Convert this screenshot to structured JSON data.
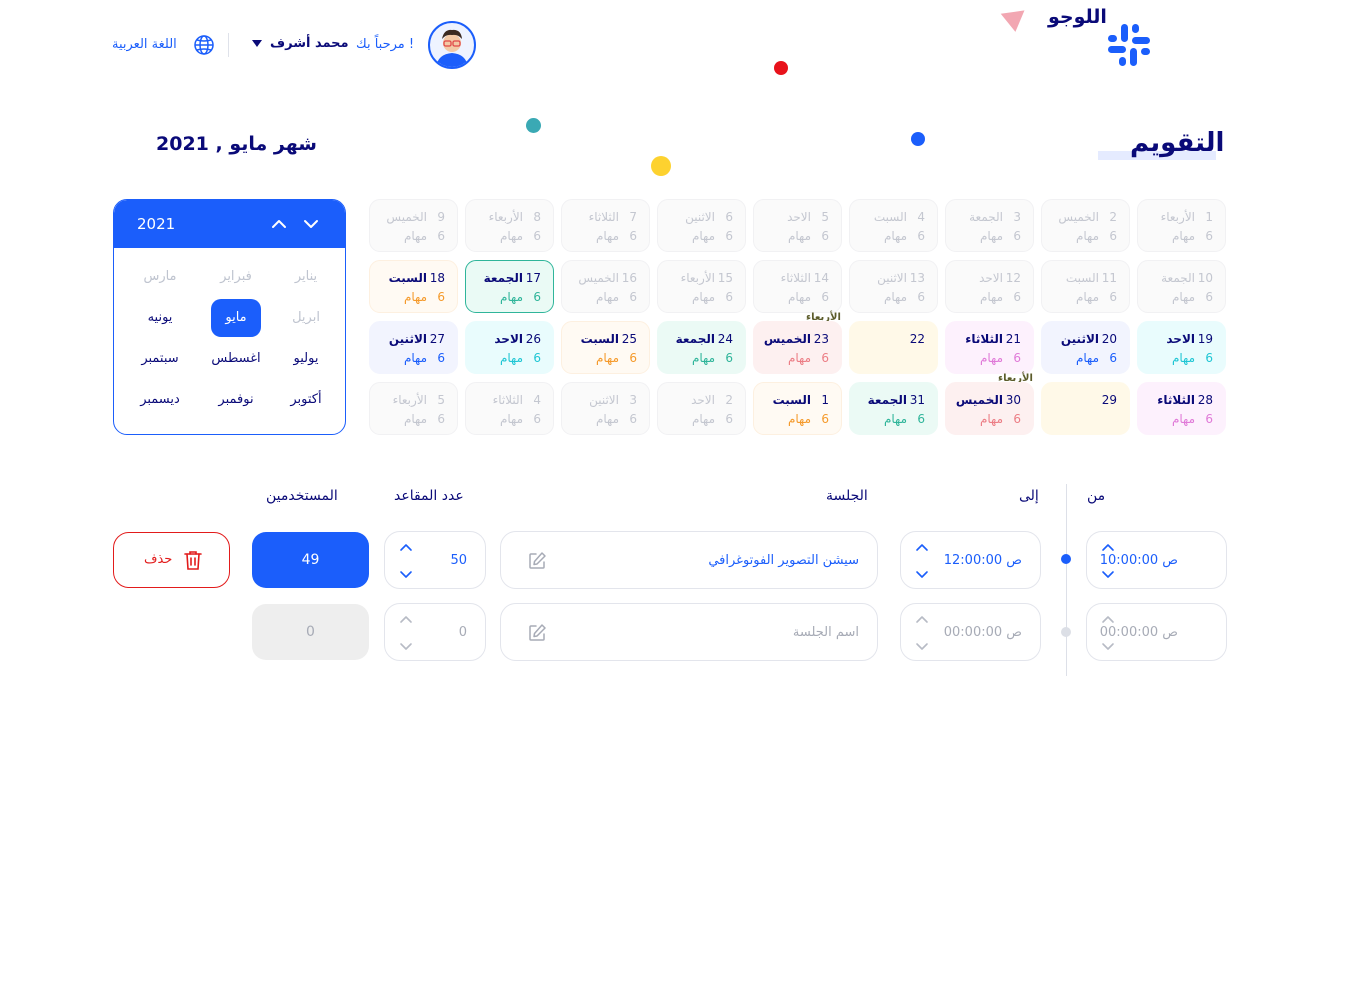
{
  "header": {
    "logo_text": "اللوجو",
    "welcome": "مرحباً بك !",
    "user_name": "محمد أشرف",
    "language": "اللغة العربية"
  },
  "titles": {
    "page_title": "التقويم",
    "month_title": "شهر مايو , 2021"
  },
  "picker": {
    "year": "2021",
    "months": [
      {
        "label": "يناير",
        "state": "faded"
      },
      {
        "label": "فبراير",
        "state": "faded"
      },
      {
        "label": "مارس",
        "state": "faded"
      },
      {
        "label": "ابريل",
        "state": "faded"
      },
      {
        "label": "مايو",
        "state": "selected"
      },
      {
        "label": "يونيه",
        "state": "normal"
      },
      {
        "label": "يوليو",
        "state": "normal"
      },
      {
        "label": "اغسطس",
        "state": "normal"
      },
      {
        "label": "سبتمبر",
        "state": "normal"
      },
      {
        "label": "أكتوبر",
        "state": "normal"
      },
      {
        "label": "نوفمبر",
        "state": "normal"
      },
      {
        "label": "ديسمبر",
        "state": "normal"
      }
    ]
  },
  "calendar": {
    "task_label": "مهام",
    "rows": [
      [
        {
          "num": "1",
          "day": "الأربعاء",
          "count": "6",
          "style": "faded"
        },
        {
          "num": "2",
          "day": "الخميس",
          "count": "6",
          "style": "faded"
        },
        {
          "num": "3",
          "day": "الجمعة",
          "count": "6",
          "style": "faded"
        },
        {
          "num": "4",
          "day": "السبت",
          "count": "6",
          "style": "faded"
        },
        {
          "num": "5",
          "day": "الاحد",
          "count": "6",
          "style": "faded"
        },
        {
          "num": "6",
          "day": "الاثنين",
          "count": "6",
          "style": "faded"
        },
        {
          "num": "7",
          "day": "الثلاثاء",
          "count": "6",
          "style": "faded"
        },
        {
          "num": "8",
          "day": "الأربعاء",
          "count": "6",
          "style": "faded"
        },
        {
          "num": "9",
          "day": "الخميس",
          "count": "6",
          "style": "faded"
        }
      ],
      [
        {
          "num": "10",
          "day": "الجمعة",
          "count": "6",
          "style": "faded"
        },
        {
          "num": "11",
          "day": "السبت",
          "count": "6",
          "style": "faded"
        },
        {
          "num": "12",
          "day": "الاحد",
          "count": "6",
          "style": "faded"
        },
        {
          "num": "13",
          "day": "الاثنين",
          "count": "6",
          "style": "faded"
        },
        {
          "num": "14",
          "day": "الثلاثاء",
          "count": "6",
          "style": "faded"
        },
        {
          "num": "15",
          "day": "الأربعاء",
          "count": "6",
          "style": "faded"
        },
        {
          "num": "16",
          "day": "الخميس",
          "count": "6",
          "style": "faded"
        },
        {
          "num": "17",
          "day": "الجمعة",
          "count": "6",
          "style": "today"
        },
        {
          "num": "18",
          "day": "السبت",
          "count": "6",
          "style": "orange"
        }
      ],
      [
        {
          "num": "19",
          "day": "الاحد",
          "count": "6",
          "style": "cyan"
        },
        {
          "num": "20",
          "day": "الاثنين",
          "count": "6",
          "style": "blue"
        },
        {
          "num": "21",
          "day": "الثلاثاء",
          "count": "6",
          "style": "pink"
        },
        {
          "num": "22",
          "day": "",
          "count": "",
          "style": "yellow",
          "tag": "الأربعاء"
        },
        {
          "num": "23",
          "day": "الخميس",
          "count": "6",
          "style": "red"
        },
        {
          "num": "24",
          "day": "الجمعة",
          "count": "6",
          "style": "green"
        },
        {
          "num": "25",
          "day": "السبت",
          "count": "6",
          "style": "orange"
        },
        {
          "num": "26",
          "day": "الاحد",
          "count": "6",
          "style": "cyan"
        },
        {
          "num": "27",
          "day": "الاثنين",
          "count": "6",
          "style": "blue"
        }
      ],
      [
        {
          "num": "28",
          "day": "الثلاثاء",
          "count": "6",
          "style": "pink"
        },
        {
          "num": "29",
          "day": "",
          "count": "",
          "style": "yellow",
          "tag": "الأربعاء"
        },
        {
          "num": "30",
          "day": "الخميس",
          "count": "6",
          "style": "red"
        },
        {
          "num": "31",
          "day": "الجمعة",
          "count": "6",
          "style": "green"
        },
        {
          "num": "1",
          "day": "السبت",
          "count": "6",
          "style": "orange"
        },
        {
          "num": "2",
          "day": "الاحد",
          "count": "6",
          "style": "faded"
        },
        {
          "num": "3",
          "day": "الاثنين",
          "count": "6",
          "style": "faded"
        },
        {
          "num": "4",
          "day": "الثلاثاء",
          "count": "6",
          "style": "faded"
        },
        {
          "num": "5",
          "day": "الأربعاء",
          "count": "6",
          "style": "faded"
        }
      ]
    ]
  },
  "form": {
    "labels": {
      "from": "من",
      "to": "إلى",
      "session": "الجلسة",
      "seats": "عدد المقاعد",
      "users": "المستخدمين"
    },
    "rows": [
      {
        "from": "10:00:00 ص",
        "to": "12:00:00 ص",
        "session": "سيشن التصوير الفوتوغرافي",
        "seats": "50",
        "users": "49",
        "active": true
      },
      {
        "from": "00:00:00 ص",
        "to": "00:00:00 ص",
        "session": "اسم الجلسة",
        "seats": "0",
        "users": "0",
        "active": false
      }
    ],
    "delete_label": "حذف"
  },
  "colors": {
    "primary": "#1b5efb",
    "navy": "#0a0a78",
    "danger": "#e21b1b"
  }
}
